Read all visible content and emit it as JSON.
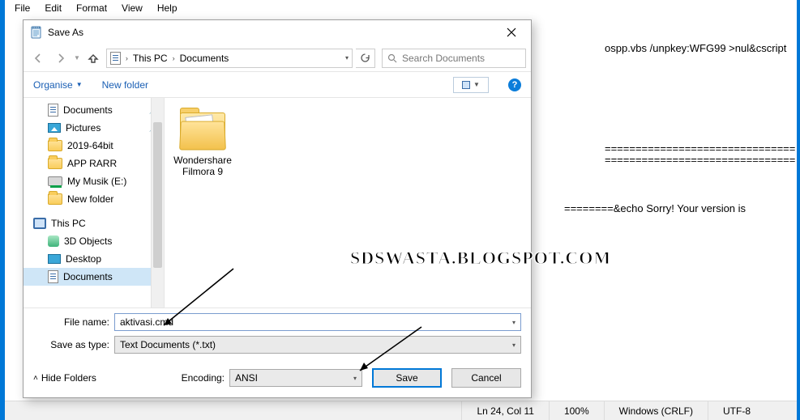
{
  "notepad": {
    "menus": [
      "File",
      "Edit",
      "Format",
      "View",
      "Help"
    ],
    "content_line1": "ospp.vbs /unpkey:WFG99 >nul&cscript",
    "content_eqline": "===============================",
    "content_sorry": "========&echo Sorry! Your version is",
    "status": {
      "pos": "Ln 24, Col 11",
      "zoom": "100%",
      "eol": "Windows (CRLF)",
      "enc": "UTF-8"
    }
  },
  "dialog": {
    "title": "Save As",
    "breadcrumb": {
      "seg1": "This PC",
      "seg2": "Documents"
    },
    "search_placeholder": "Search Documents",
    "toolbar": {
      "organise": "Organise",
      "newfolder": "New folder"
    },
    "tree": {
      "documents": "Documents",
      "pictures": "Pictures",
      "y2019": "2019-64bit",
      "apprarr": "APP RARR",
      "mymusik": "My Musik (E:)",
      "newfolder": "New folder",
      "thispc": "This PC",
      "objects3d": "3D Objects",
      "desktop": "Desktop",
      "docs2": "Documents"
    },
    "file_item": "Wondershare Filmora 9",
    "labels": {
      "filename": "File name:",
      "saveas": "Save as type:",
      "encoding": "Encoding:",
      "hide": "Hide Folders"
    },
    "filename_value": "aktivasi.cmd",
    "saveas_value": "Text Documents (*.txt)",
    "encoding_value": "ANSI",
    "buttons": {
      "save": "Save",
      "cancel": "Cancel"
    }
  },
  "watermark": "SDSWASTA.BLOGSPOT.COM"
}
